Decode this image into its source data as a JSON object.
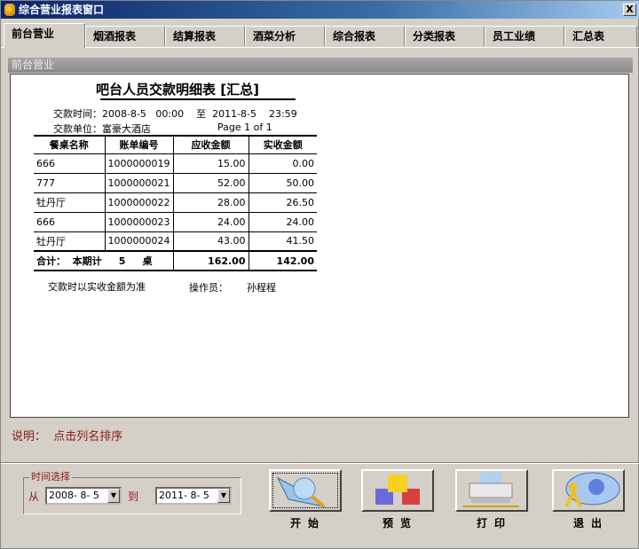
{
  "window": {
    "title": "综合营业报表窗口",
    "close": "X"
  },
  "tabs": [
    "前台营业",
    "烟酒报表",
    "结算报表",
    "酒菜分析",
    "综合报表",
    "分类报表",
    "员工业绩",
    "汇总表"
  ],
  "panel": {
    "header": "前台营业"
  },
  "report": {
    "title": "吧台人员交款明细表 [汇总]",
    "time_range": "交款时间：2008-8-5   00:00    至  2011-8-5    23:59",
    "unit": "交款单位：富豪大酒店",
    "page": "Page 1 of 1",
    "columns": [
      "餐桌名称",
      "账单编号",
      "应收金额",
      "实收金额"
    ],
    "rows": [
      [
        "666",
        "1000000019",
        "15.00",
        "0.00"
      ],
      [
        "777",
        "1000000021",
        "52.00",
        "50.00"
      ],
      [
        "牡丹厅",
        "1000000022",
        "28.00",
        "26.50"
      ],
      [
        "666",
        "1000000023",
        "24.00",
        "24.00"
      ],
      [
        "牡丹厅",
        "1000000024",
        "43.00",
        "41.50"
      ]
    ],
    "total": {
      "label": "合计：  本期计     5     桌",
      "due": "162.00",
      "paid": "142.00"
    },
    "footer_note": "交款时以实收金额为准",
    "operator_label": "操作员：",
    "operator": "孙程程"
  },
  "note": "说明：  点击列名排序",
  "time_select": {
    "label": "时间选择",
    "from_label": "从",
    "from": "2008- 8- 5",
    "to_label": "到",
    "to": "2011- 8- 5"
  },
  "buttons": [
    "开始",
    "预览",
    "打印",
    "退出"
  ]
}
